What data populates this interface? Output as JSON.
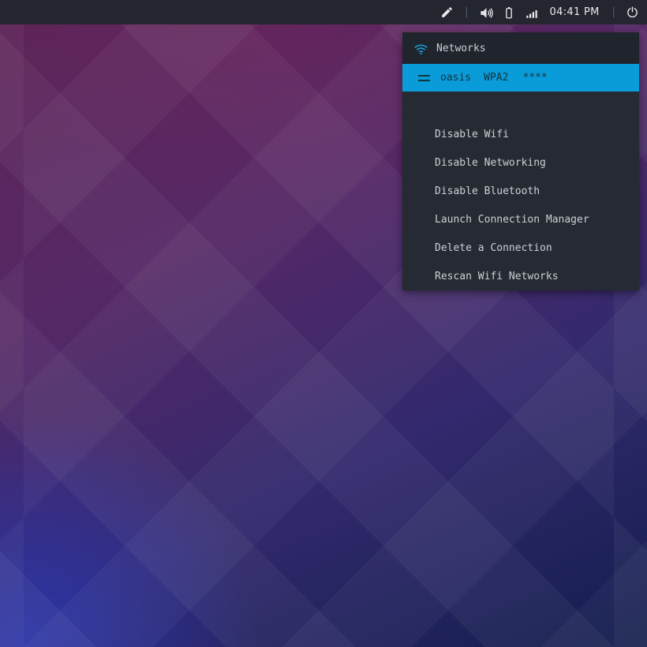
{
  "taskbar": {
    "separator": "|",
    "time": "04:41 PM",
    "icons": [
      "pencil-icon",
      "volume-icon",
      "battery-icon",
      "signal-icon",
      "power-icon"
    ]
  },
  "menu": {
    "header": {
      "label": "Networks",
      "icon": "wifi-icon"
    },
    "selected_network": {
      "icon": "signal-strength-icon",
      "ssid": "oasis",
      "security": "WPA2",
      "password_mask": "****"
    },
    "items": [
      {
        "label": "Disable Wifi"
      },
      {
        "label": "Disable Networking"
      },
      {
        "label": "Disable Bluetooth"
      },
      {
        "label": "Launch Connection Manager"
      },
      {
        "label": "Delete a Connection"
      },
      {
        "label": "Rescan Wifi Networks"
      }
    ]
  },
  "colors": {
    "accent_blue": "#0a9cd8",
    "wifi_icon_blue": "#1a9ad6",
    "taskbar_bg": "#23262e",
    "menu_header_bg": "#20242c",
    "menu_bg": "#262a33",
    "menu_text": "#ccd0d5",
    "selected_text": "#12333f",
    "wallpaper_purple": "#5e2456",
    "wallpaper_navy": "#131e4e"
  }
}
